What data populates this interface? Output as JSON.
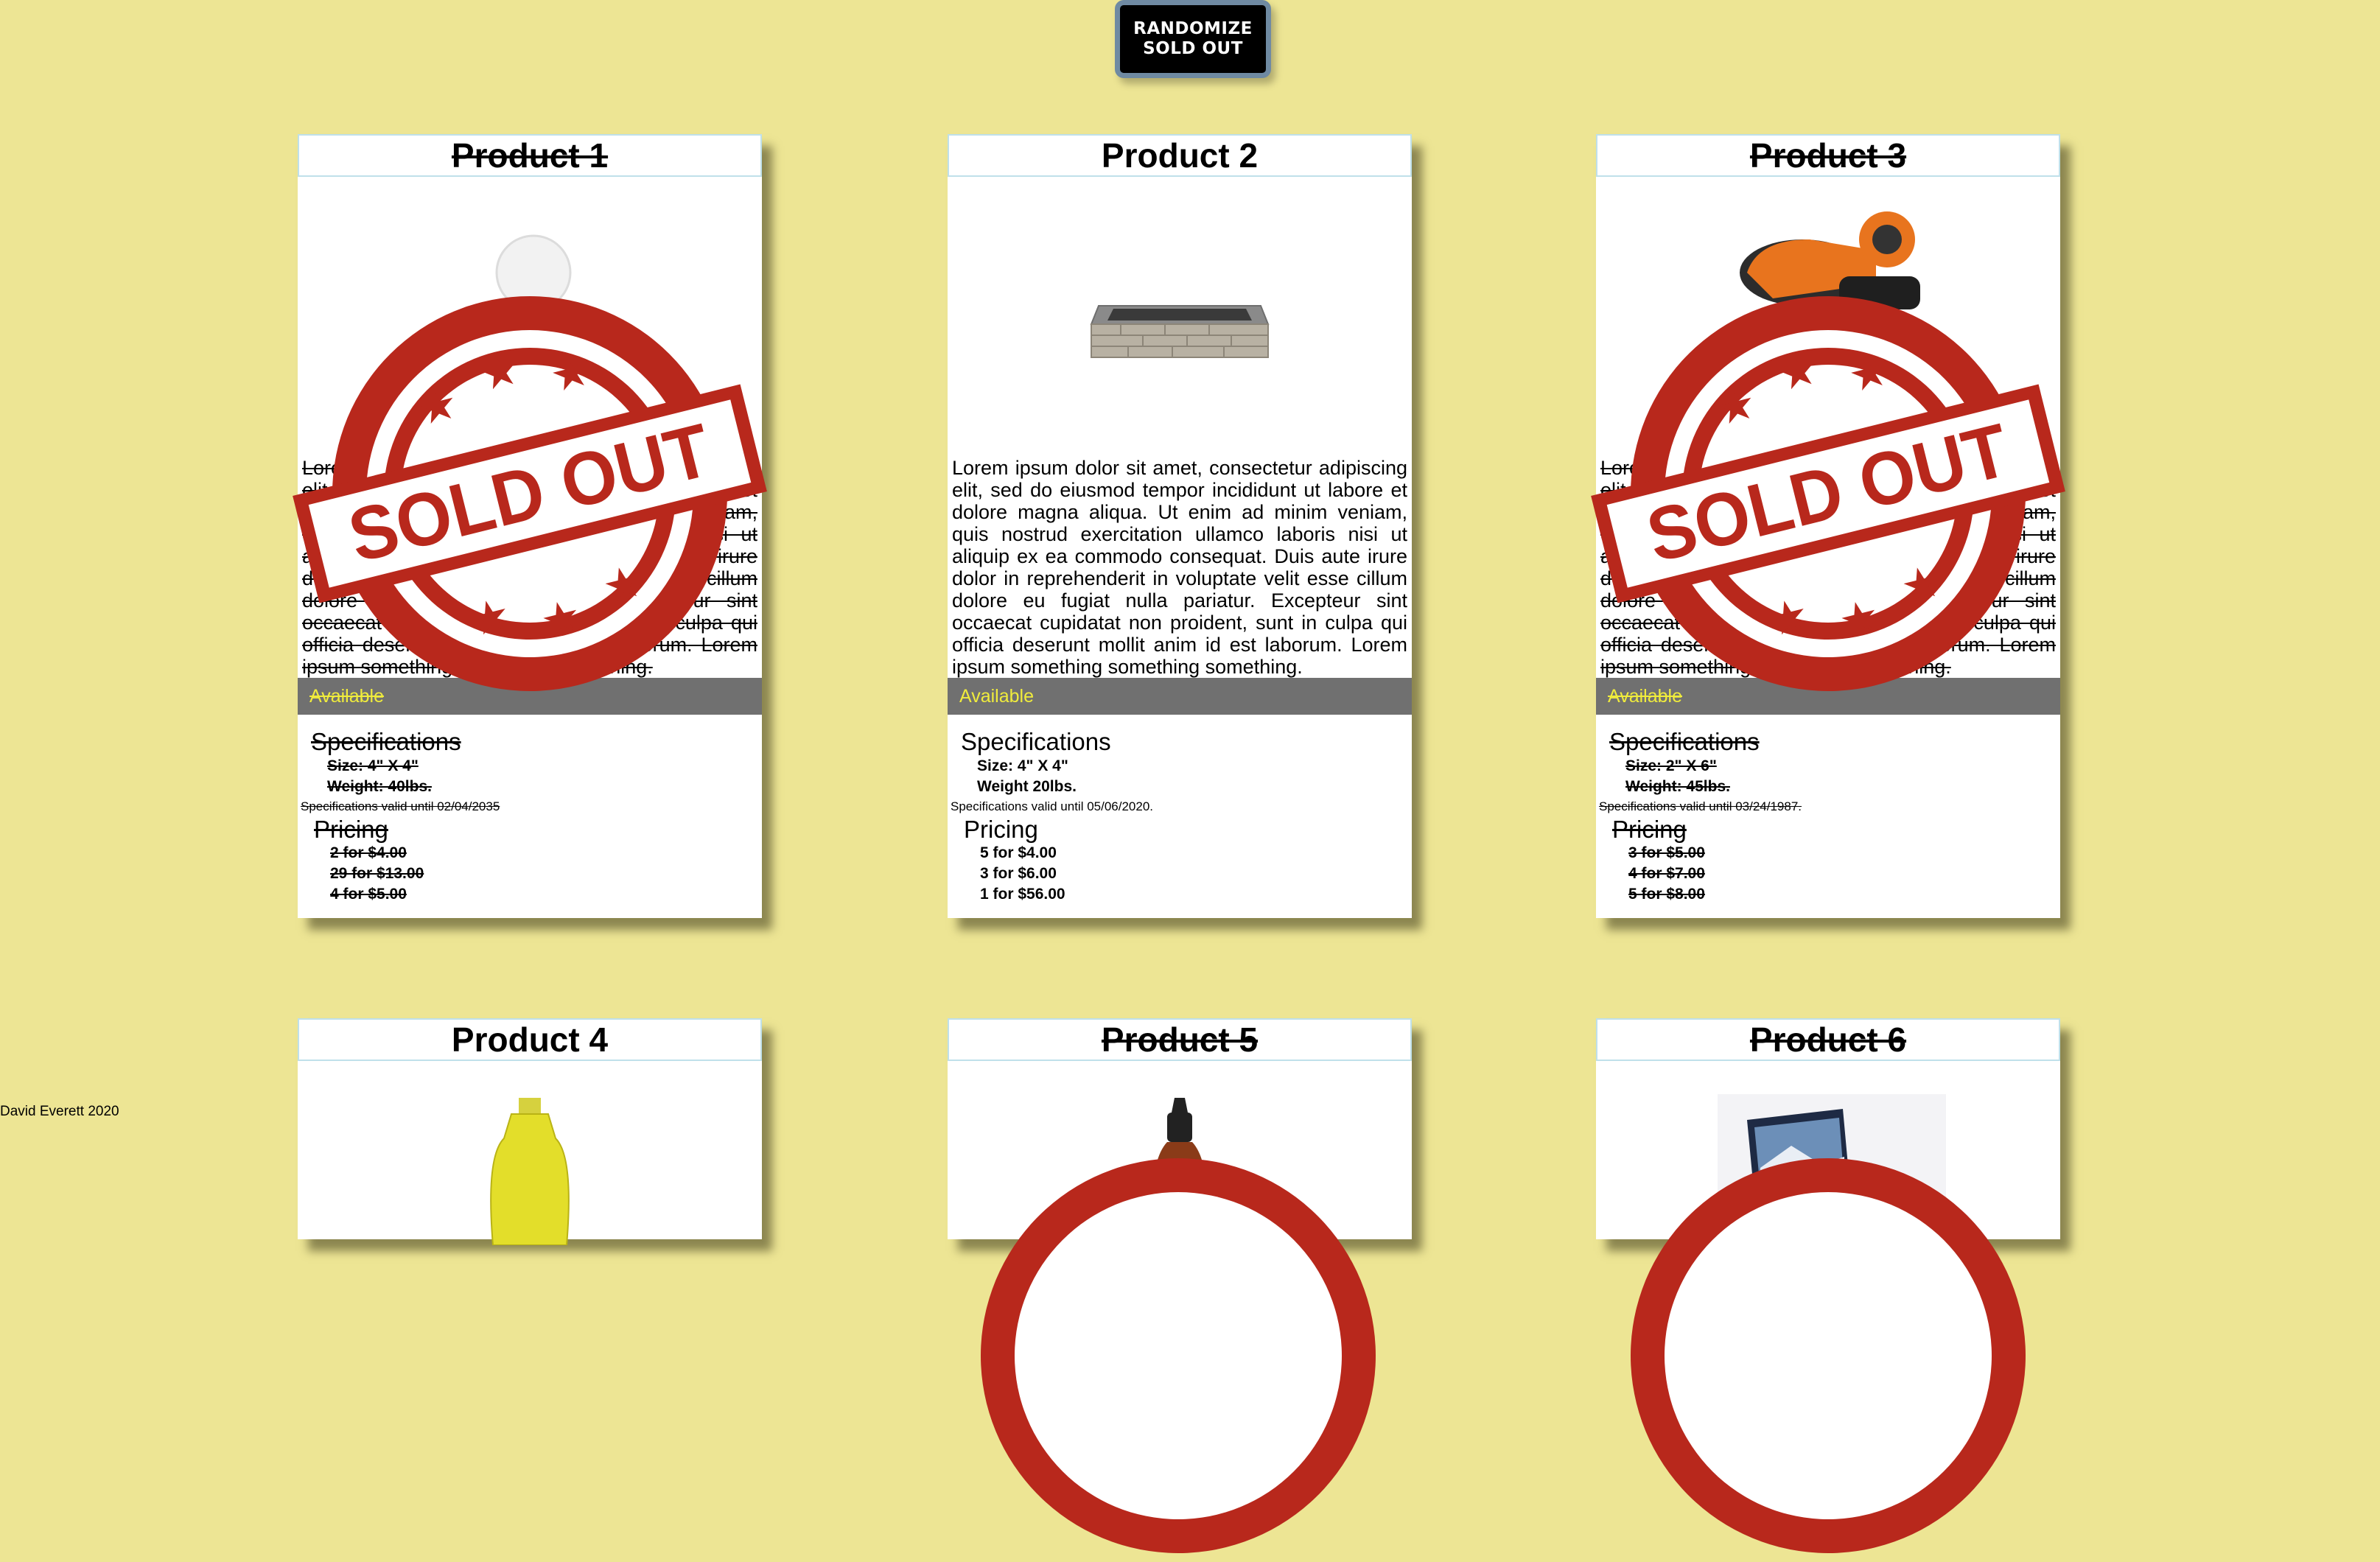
{
  "randomize_button": {
    "line1": "RANDOMIZE",
    "line2": "SOLD OUT"
  },
  "footer": "David Everett 2020",
  "stamp_text": "SOLD OUT",
  "colors": {
    "background": "#ede594",
    "available_bar": "#707070",
    "available_text": "#f0ec3c",
    "stamp_red": "#b8281c"
  },
  "lorem": "Lorem ipsum dolor sit amet, consectetur adipiscing elit, sed do eiusmod tempor incididunt ut labore et dolore magna aliqua. Ut enim ad minim veniam, quis nostrud exercitation ullamco laboris nisi ut aliquip ex ea commodo consequat. Duis aute irure dolor in reprehenderit in voluptate velit esse cillum dolore eu fugiat nulla pariatur. Excepteur sint occaecat cupidatat non proident, sunt in culpa qui officia deserunt mollit anim id est laborum. Lorem ipsum something something something.",
  "products": [
    {
      "title": "Product 1",
      "image_icon": "light-bulb-icon",
      "sold_out": true,
      "availability": "Available",
      "specifications_heading": "Specifications",
      "size": "Size: 4\" X 4\"",
      "weight": "Weight: 40lbs.",
      "valid": "Specifications valid until 02/04/2035",
      "pricing_heading": "Pricing",
      "prices": [
        "2 for $4.00",
        "29 for $13.00",
        "4 for $5.00"
      ]
    },
    {
      "title": "Product 2",
      "image_icon": "fire-pit-icon",
      "sold_out": false,
      "availability": "Available",
      "specifications_heading": "Specifications",
      "size": "Size: 4\" X 4\"",
      "weight": "Weight 20lbs.",
      "valid": "Specifications valid until 05/06/2020.",
      "pricing_heading": "Pricing",
      "prices": [
        "5 for $4.00",
        "3 for $6.00",
        "1 for $56.00"
      ]
    },
    {
      "title": "Product 3",
      "image_icon": "power-sander-icon",
      "sold_out": true,
      "availability": "Available",
      "specifications_heading": "Specifications",
      "size": "Size: 2\" X 6\"",
      "weight": "Weight: 45lbs.",
      "valid": "Specifications valid until 03/24/1987.",
      "pricing_heading": "Pricing",
      "prices": [
        "3 for $5.00",
        "4 for $7.00",
        "5 for $8.00"
      ]
    },
    {
      "title": "Product 4",
      "image_icon": "oil-bottle-icon",
      "sold_out": false
    },
    {
      "title": "Product 5",
      "image_icon": "sauce-bottle-icon",
      "sold_out": true
    },
    {
      "title": "Product 6",
      "image_icon": "laptop-icon",
      "sold_out": true
    }
  ]
}
